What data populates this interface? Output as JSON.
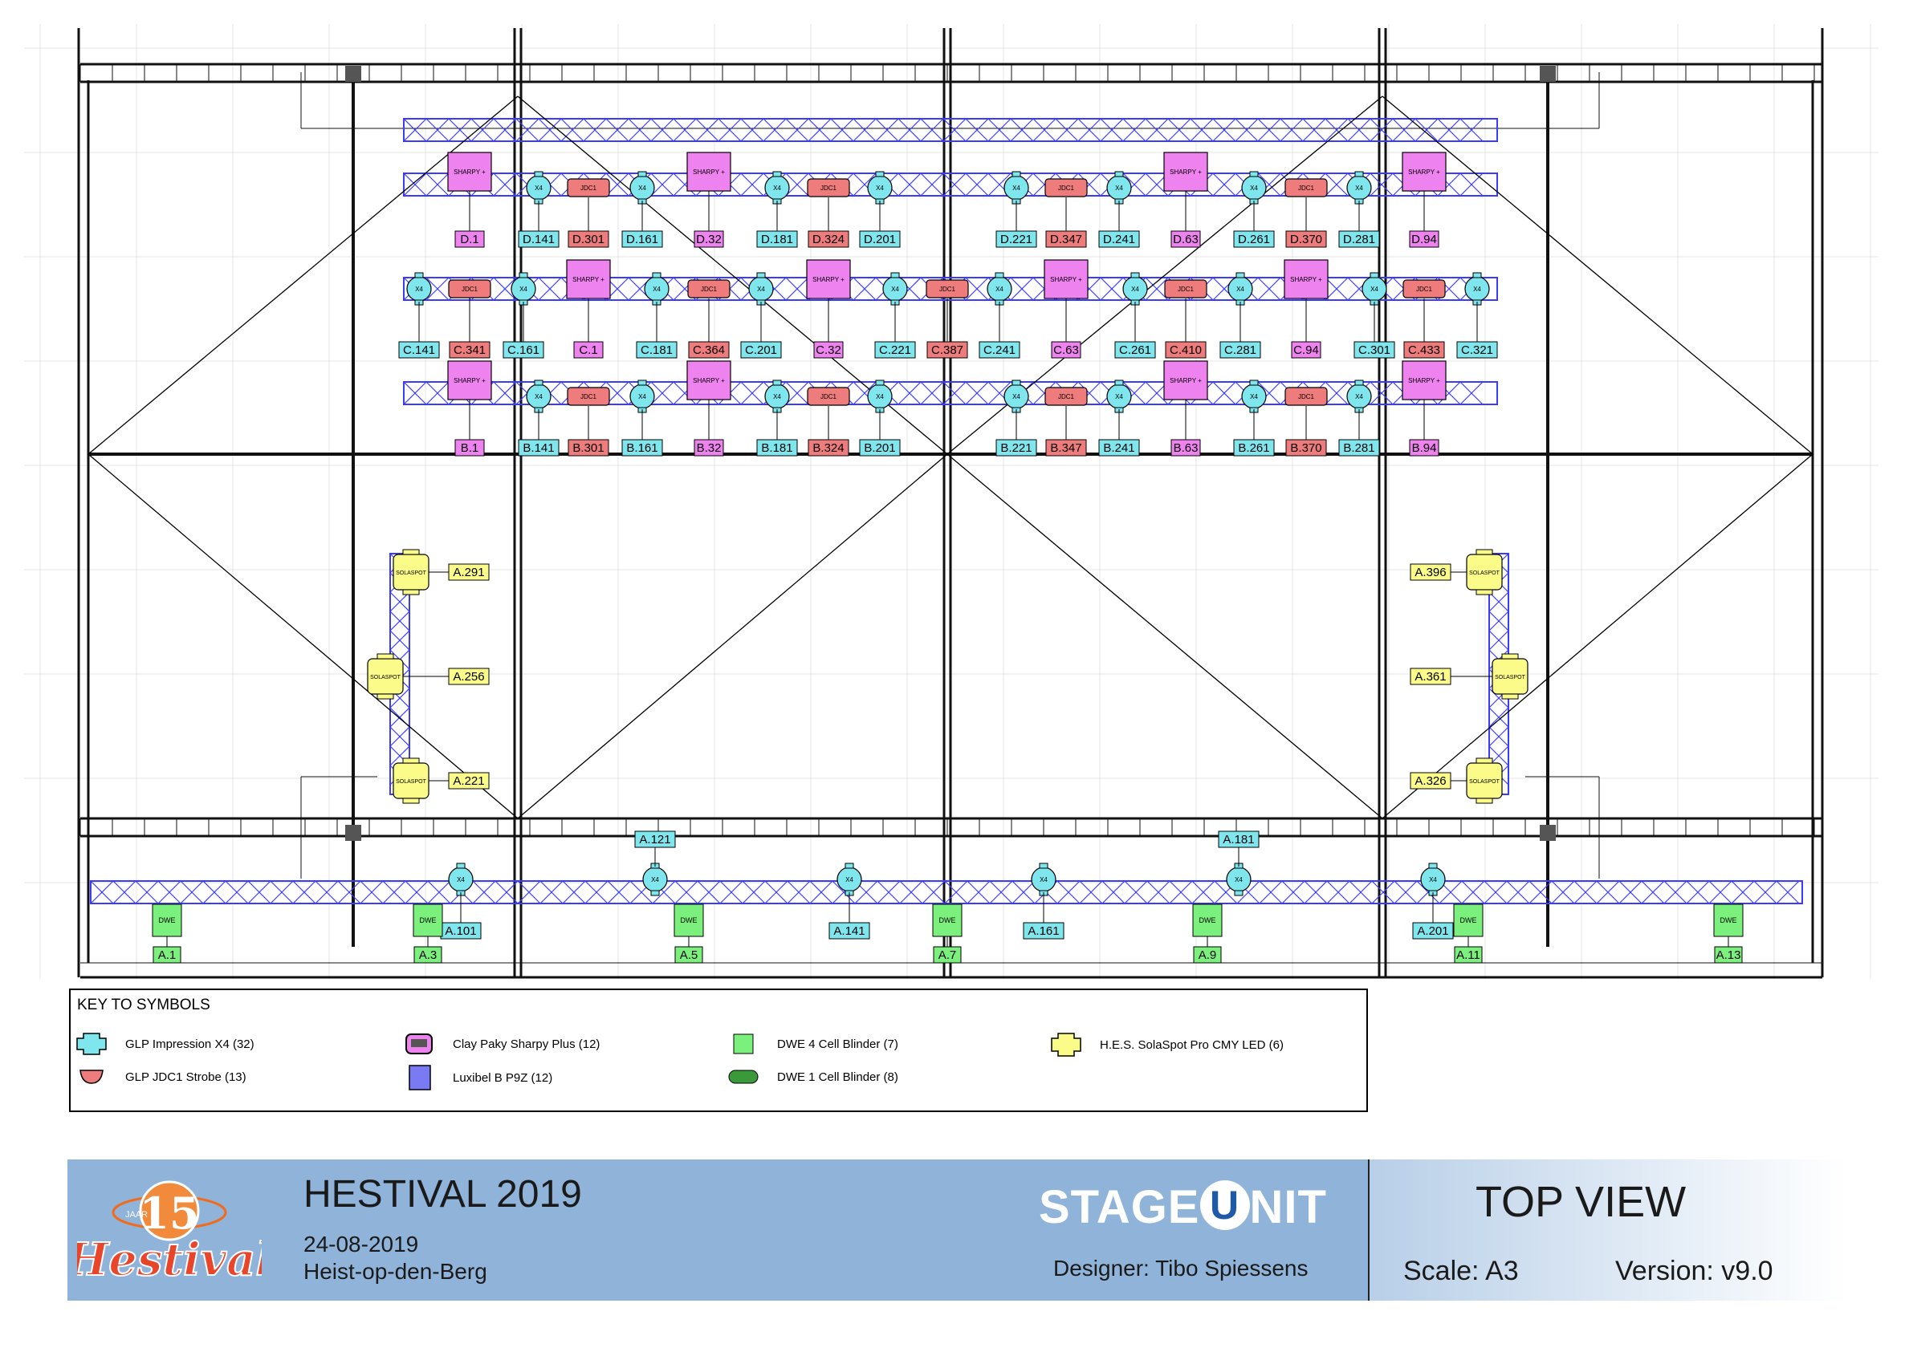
{
  "drawing": {
    "colors": {
      "truss": "#3b3bff",
      "structure": "#111111",
      "x4": "#7fe6ee",
      "jdc1": "#ef7c7c",
      "sharpy": "#ee82ee",
      "dwe": "#7cf07c",
      "solaspot": "#fbfb8a",
      "grid": "#e4e4e4"
    },
    "sharpy_text": "SHARPY +",
    "jdc_text": "JDC1",
    "x4_text": "X4",
    "dwe_text": "DWE",
    "sola_text": "SOLASPOT",
    "rows": {
      "D": {
        "sharpy": [
          "D.1",
          "D.32",
          "D.63",
          "D.94"
        ],
        "x4": [
          "D.141",
          "D.161",
          "D.181",
          "D.201",
          "D.221",
          "D.241",
          "D.261",
          "D.281"
        ],
        "jdc": [
          "D.301",
          "D.324",
          "D.347",
          "D.370"
        ]
      },
      "C": {
        "sharpy": [
          "C.1",
          "C.32",
          "C.63",
          "C.94"
        ],
        "x4": [
          "C.141",
          "C.161",
          "C.181",
          "C.201",
          "C.221",
          "C.241",
          "C.261",
          "C.281",
          "C.301",
          "C.321"
        ],
        "jdc": [
          "C.341",
          "C.364",
          "C.387",
          "C.410",
          "C.433"
        ]
      },
      "B": {
        "sharpy": [
          "B.1",
          "B.32",
          "B.63",
          "B.94"
        ],
        "x4": [
          "B.141",
          "B.161",
          "B.181",
          "B.201",
          "B.221",
          "B.241",
          "B.261",
          "B.281"
        ],
        "jdc": [
          "B.301",
          "B.324",
          "B.347",
          "B.370"
        ]
      }
    },
    "front_x4": [
      "A.101",
      "A.121",
      "A.141",
      "A.161",
      "A.181",
      "A.201"
    ],
    "front_dwe": [
      "A.1",
      "A.3",
      "A.5",
      "A.7",
      "A.9",
      "A.11",
      "A.13"
    ],
    "sola_left": [
      "A.291",
      "A.256",
      "A.221"
    ],
    "sola_right": [
      "A.396",
      "A.361",
      "A.326"
    ]
  },
  "key": {
    "title": "KEY TO SYMBOLS",
    "items": [
      {
        "name": "x4-key-icon",
        "label": "GLP Impression X4 (32)"
      },
      {
        "name": "jdc1-key-icon",
        "label": "GLP JDC1 Strobe (13)"
      },
      {
        "name": "sharpy-key-icon",
        "label": "Clay Paky Sharpy Plus (12)"
      },
      {
        "name": "luxibel-key-icon",
        "label": "Luxibel B P9Z (12)"
      },
      {
        "name": "dwe4-key-icon",
        "label": "DWE 4 Cell Blinder (7)"
      },
      {
        "name": "dwe1-key-icon",
        "label": "DWE 1 Cell Blinder (8)"
      },
      {
        "name": "solaspot-key-icon",
        "label": "H.E.S. SolaSpot Pro CMY LED (6)"
      }
    ]
  },
  "titleblock": {
    "logo_number": "15",
    "logo_small": "JAAR",
    "logo_word": "Hestival",
    "event": "HESTIVAL 2019",
    "date": "24-08-2019",
    "place": "Heist-op-den-Berg",
    "brand_a": "STAGE",
    "brand_b": "U",
    "brand_c": "NIT",
    "designer": "Designer: Tibo Spiessens",
    "view": "TOP VIEW",
    "scale": "Scale: A3",
    "version": "Version: v9.0"
  }
}
